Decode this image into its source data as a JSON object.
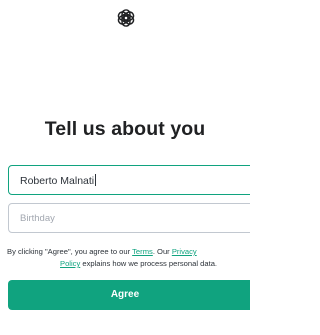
{
  "header": {
    "logo_icon": "openai-logo-icon"
  },
  "main": {
    "title": "Tell us about you",
    "name_field": {
      "value": "Roberto Malnati"
    },
    "birthday_field": {
      "placeholder": "Birthday"
    },
    "legal": {
      "prefix": "By clicking \"Agree\", you agree to our ",
      "terms_link": "Terms",
      "middle": ". Our ",
      "privacy_link_line1": "Privacy",
      "privacy_link_line2": "Policy",
      "suffix": " explains how we process personal data."
    },
    "agree_button": "Agree"
  },
  "colors": {
    "accent": "#10a37f",
    "text": "#202123",
    "placeholder": "#a2a7b0",
    "border": "#c2c8d0"
  }
}
